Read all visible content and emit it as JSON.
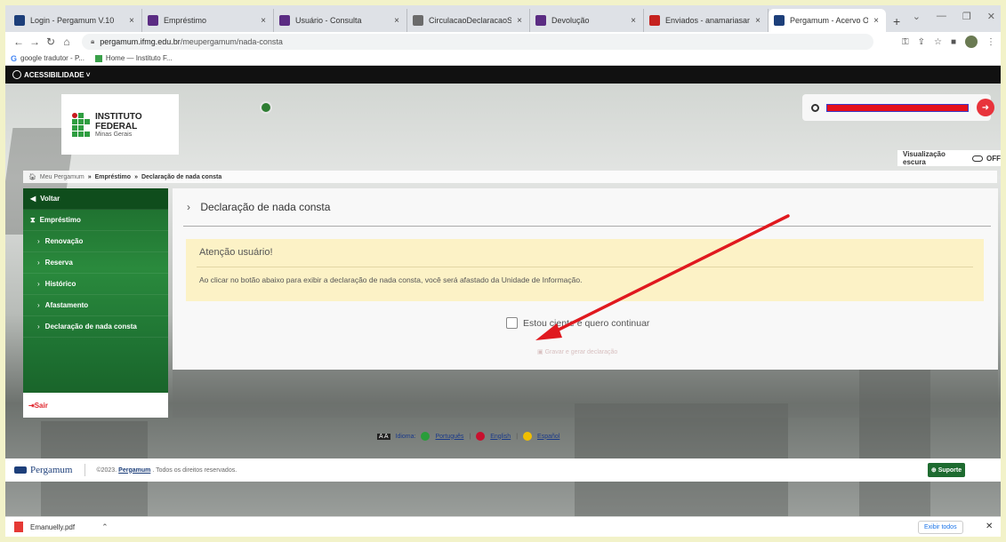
{
  "browser": {
    "tabs": [
      {
        "title": "Login - Pergamum V.10",
        "color": "#1d3f7a"
      },
      {
        "title": "Empréstimo",
        "color": "#5b2c83"
      },
      {
        "title": "Usuário - Consulta",
        "color": "#5b2c83"
      },
      {
        "title": "CirculacaoDeclaracaoServlet",
        "color": "#6b6b6b"
      },
      {
        "title": "Devolução",
        "color": "#5b2c83"
      },
      {
        "title": "Enviados - anamariasamora@",
        "color": "#c5221f"
      },
      {
        "title": "Pergamum - Acervo Online",
        "color": "#1d3f7a"
      }
    ],
    "new_tab": "+",
    "close_glyph": "×",
    "url_host": "pergamum.ifmg.edu.br",
    "url_path": "/meupergamum/nada-consta",
    "bookmarks": [
      {
        "label": "google tradutor - P...",
        "icon": "google-icon"
      },
      {
        "label": "Home — Instituto F...",
        "icon": "site-icon"
      }
    ]
  },
  "page": {
    "accessibility_label": "ACESSIBILIDADE ˅",
    "logo": {
      "title": "INSTITUTO FEDERAL",
      "subtitle": "Minas Gerais"
    },
    "dark_mode_label": "Visualização escura",
    "dark_mode_state": "OFF",
    "breadcrumb": {
      "home": "Meu Pergamum",
      "separator": "»",
      "level1": "Empréstimo",
      "current": "Declaração de nada consta"
    },
    "sidebar": {
      "back": "Voltar",
      "section": "Empréstimo",
      "items": [
        "Renovação",
        "Reserva",
        "Histórico",
        "Afastamento",
        "Declaração de nada consta"
      ],
      "exit": "Sair"
    },
    "content": {
      "title": "Declaração de nada consta",
      "alert_title": "Atenção usuário!",
      "alert_text": "Ao clicar no botão abaixo para exibir a declaração de nada consta, você será afastado da Unidade de Informação.",
      "ack_label": "Estou ciente e quero continuar",
      "generate_button": "Gravar e gerar declaração"
    },
    "languages": {
      "current": "Idioma:",
      "options": [
        "Português",
        "English",
        "Español"
      ]
    },
    "footer": {
      "brand": "Pergamum",
      "copyright_prefix": "©2023.",
      "copyright_link": "Pergamum",
      "copyright_suffix": ". Todos os direitos reservados.",
      "support": "Suporte"
    }
  },
  "downloads": {
    "file": "Emanuelly.pdf",
    "show_all": "Exibir todos"
  },
  "colors": {
    "accent_green": "#1e6b30",
    "annotation_arrow": "#e0191f"
  }
}
